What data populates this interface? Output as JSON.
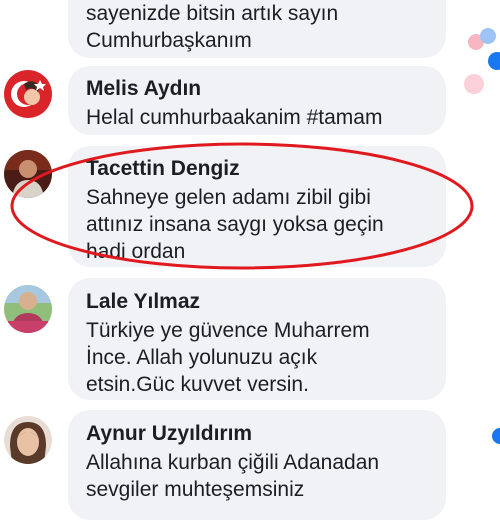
{
  "comments": [
    {
      "name": "",
      "text": "sayenizde bitsin artık sayın\nCumhurbaşkanım"
    },
    {
      "name": "Melis Aydın",
      "text": "Helal cumhurbaakanim #tamam"
    },
    {
      "name": "Tacettin Dengiz",
      "text": "Sahneye gelen adamı zibil gibi\nattınız insana saygı yoksa geçin\nhadi ordan"
    },
    {
      "name": "Lale Yılmaz",
      "text": "Türkiye ye güvence Muharrem\nİnce. Allah yolunuzu açık\netsin.Güc kuvvet versin."
    },
    {
      "name": "Aynur Uzyıldırım",
      "text": "Allahına kurban çiğili Adanadan\nsevgiler muhteşemsiniz"
    }
  ],
  "colors": {
    "bubble": "#f0f2f5",
    "text": "#1c1e21",
    "highlight_ellipse": "#e0191f",
    "like_blue": "#1877f2",
    "love_red": "#f33e58"
  },
  "icons": [
    "like-reaction-icon",
    "love-reaction-icon"
  ]
}
